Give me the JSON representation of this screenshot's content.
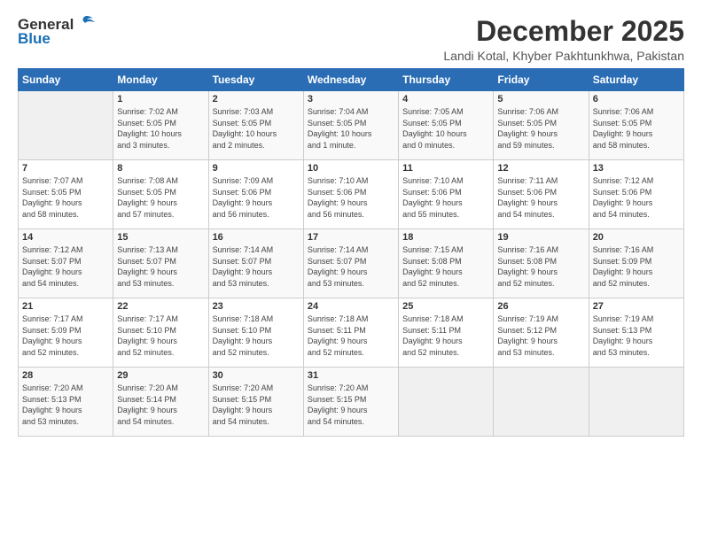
{
  "logo": {
    "general": "General",
    "blue": "Blue"
  },
  "title": "December 2025",
  "location": "Landi Kotal, Khyber Pakhtunkhwa, Pakistan",
  "days_of_week": [
    "Sunday",
    "Monday",
    "Tuesday",
    "Wednesday",
    "Thursday",
    "Friday",
    "Saturday"
  ],
  "weeks": [
    [
      {
        "day": "",
        "text": ""
      },
      {
        "day": "1",
        "text": "Sunrise: 7:02 AM\nSunset: 5:05 PM\nDaylight: 10 hours\nand 3 minutes."
      },
      {
        "day": "2",
        "text": "Sunrise: 7:03 AM\nSunset: 5:05 PM\nDaylight: 10 hours\nand 2 minutes."
      },
      {
        "day": "3",
        "text": "Sunrise: 7:04 AM\nSunset: 5:05 PM\nDaylight: 10 hours\nand 1 minute."
      },
      {
        "day": "4",
        "text": "Sunrise: 7:05 AM\nSunset: 5:05 PM\nDaylight: 10 hours\nand 0 minutes."
      },
      {
        "day": "5",
        "text": "Sunrise: 7:06 AM\nSunset: 5:05 PM\nDaylight: 9 hours\nand 59 minutes."
      },
      {
        "day": "6",
        "text": "Sunrise: 7:06 AM\nSunset: 5:05 PM\nDaylight: 9 hours\nand 58 minutes."
      }
    ],
    [
      {
        "day": "7",
        "text": "Sunrise: 7:07 AM\nSunset: 5:05 PM\nDaylight: 9 hours\nand 58 minutes."
      },
      {
        "day": "8",
        "text": "Sunrise: 7:08 AM\nSunset: 5:05 PM\nDaylight: 9 hours\nand 57 minutes."
      },
      {
        "day": "9",
        "text": "Sunrise: 7:09 AM\nSunset: 5:06 PM\nDaylight: 9 hours\nand 56 minutes."
      },
      {
        "day": "10",
        "text": "Sunrise: 7:10 AM\nSunset: 5:06 PM\nDaylight: 9 hours\nand 56 minutes."
      },
      {
        "day": "11",
        "text": "Sunrise: 7:10 AM\nSunset: 5:06 PM\nDaylight: 9 hours\nand 55 minutes."
      },
      {
        "day": "12",
        "text": "Sunrise: 7:11 AM\nSunset: 5:06 PM\nDaylight: 9 hours\nand 54 minutes."
      },
      {
        "day": "13",
        "text": "Sunrise: 7:12 AM\nSunset: 5:06 PM\nDaylight: 9 hours\nand 54 minutes."
      }
    ],
    [
      {
        "day": "14",
        "text": "Sunrise: 7:12 AM\nSunset: 5:07 PM\nDaylight: 9 hours\nand 54 minutes."
      },
      {
        "day": "15",
        "text": "Sunrise: 7:13 AM\nSunset: 5:07 PM\nDaylight: 9 hours\nand 53 minutes."
      },
      {
        "day": "16",
        "text": "Sunrise: 7:14 AM\nSunset: 5:07 PM\nDaylight: 9 hours\nand 53 minutes."
      },
      {
        "day": "17",
        "text": "Sunrise: 7:14 AM\nSunset: 5:07 PM\nDaylight: 9 hours\nand 53 minutes."
      },
      {
        "day": "18",
        "text": "Sunrise: 7:15 AM\nSunset: 5:08 PM\nDaylight: 9 hours\nand 52 minutes."
      },
      {
        "day": "19",
        "text": "Sunrise: 7:16 AM\nSunset: 5:08 PM\nDaylight: 9 hours\nand 52 minutes."
      },
      {
        "day": "20",
        "text": "Sunrise: 7:16 AM\nSunset: 5:09 PM\nDaylight: 9 hours\nand 52 minutes."
      }
    ],
    [
      {
        "day": "21",
        "text": "Sunrise: 7:17 AM\nSunset: 5:09 PM\nDaylight: 9 hours\nand 52 minutes."
      },
      {
        "day": "22",
        "text": "Sunrise: 7:17 AM\nSunset: 5:10 PM\nDaylight: 9 hours\nand 52 minutes."
      },
      {
        "day": "23",
        "text": "Sunrise: 7:18 AM\nSunset: 5:10 PM\nDaylight: 9 hours\nand 52 minutes."
      },
      {
        "day": "24",
        "text": "Sunrise: 7:18 AM\nSunset: 5:11 PM\nDaylight: 9 hours\nand 52 minutes."
      },
      {
        "day": "25",
        "text": "Sunrise: 7:18 AM\nSunset: 5:11 PM\nDaylight: 9 hours\nand 52 minutes."
      },
      {
        "day": "26",
        "text": "Sunrise: 7:19 AM\nSunset: 5:12 PM\nDaylight: 9 hours\nand 53 minutes."
      },
      {
        "day": "27",
        "text": "Sunrise: 7:19 AM\nSunset: 5:13 PM\nDaylight: 9 hours\nand 53 minutes."
      }
    ],
    [
      {
        "day": "28",
        "text": "Sunrise: 7:20 AM\nSunset: 5:13 PM\nDaylight: 9 hours\nand 53 minutes."
      },
      {
        "day": "29",
        "text": "Sunrise: 7:20 AM\nSunset: 5:14 PM\nDaylight: 9 hours\nand 54 minutes."
      },
      {
        "day": "30",
        "text": "Sunrise: 7:20 AM\nSunset: 5:15 PM\nDaylight: 9 hours\nand 54 minutes."
      },
      {
        "day": "31",
        "text": "Sunrise: 7:20 AM\nSunset: 5:15 PM\nDaylight: 9 hours\nand 54 minutes."
      },
      {
        "day": "",
        "text": ""
      },
      {
        "day": "",
        "text": ""
      },
      {
        "day": "",
        "text": ""
      }
    ]
  ]
}
